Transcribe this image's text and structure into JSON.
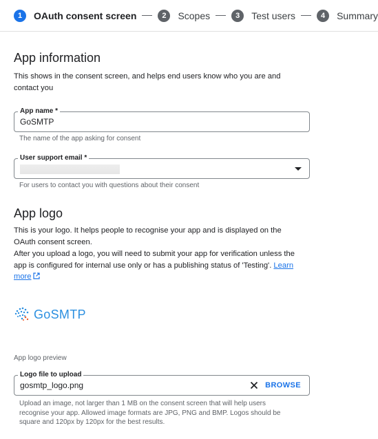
{
  "stepper": {
    "steps": [
      {
        "number": "1",
        "label": "OAuth consent screen",
        "active": true
      },
      {
        "number": "2",
        "label": "Scopes",
        "active": false
      },
      {
        "number": "3",
        "label": "Test users",
        "active": false
      },
      {
        "number": "4",
        "label": "Summary",
        "active": false
      }
    ]
  },
  "app_info": {
    "title": "App information",
    "description": "This shows in the consent screen, and helps end users know who you are and contact you",
    "app_name": {
      "label": "App name *",
      "value": "GoSMTP",
      "hint": "The name of the app asking for consent"
    },
    "support_email": {
      "label": "User support email *",
      "hint": "For users to contact you with questions about their consent"
    }
  },
  "app_logo": {
    "title": "App logo",
    "description_1": "This is your logo. It helps people to recognise your app and is displayed on the OAuth consent screen.",
    "description_2": "After you upload a logo, you will need to submit your app for verification unless the app is configured for internal use only or has a publishing status of 'Testing'.",
    "learn_more": "Learn more",
    "logo_text": "GoSMTP",
    "preview_label": "App logo preview",
    "file_field": {
      "label": "Logo file to upload",
      "value": "gosmtp_logo.png",
      "browse": "BROWSE",
      "hint": "Upload an image, not larger than 1 MB on the consent screen that will help users recognise your app. Allowed image formats are JPG, PNG and BMP. Logos should be square and 120px by 120px for the best results."
    }
  },
  "colors": {
    "accent": "#1a73e8",
    "logo": "#2b8fe0",
    "step_inactive": "#5f6368"
  }
}
